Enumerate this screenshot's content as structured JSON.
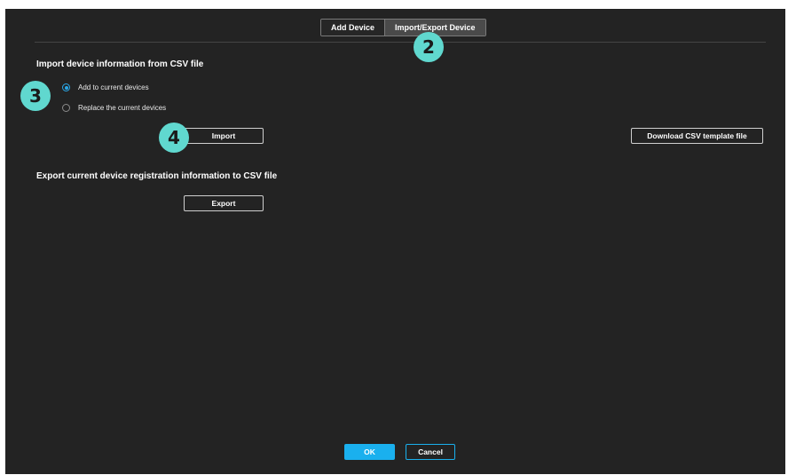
{
  "tabs": [
    {
      "label": "Add Device",
      "active": false
    },
    {
      "label": "Import/Export Device",
      "active": true
    }
  ],
  "import_section": {
    "title": "Import device information from CSV file",
    "options": [
      {
        "label": "Add to current devices",
        "checked": true
      },
      {
        "label": "Replace the current devices",
        "checked": false
      }
    ],
    "import_button": "Import",
    "download_template_button": "Download CSV template file"
  },
  "export_section": {
    "title": "Export current device registration information to CSV file",
    "export_button": "Export"
  },
  "footer": {
    "ok_label": "OK",
    "cancel_label": "Cancel"
  },
  "step_badges": {
    "tab_step": "2",
    "option_step": "3",
    "import_step": "4"
  },
  "colors": {
    "background": "#232323",
    "accent": "#1ab0ee",
    "badge": "#60d8cf"
  }
}
